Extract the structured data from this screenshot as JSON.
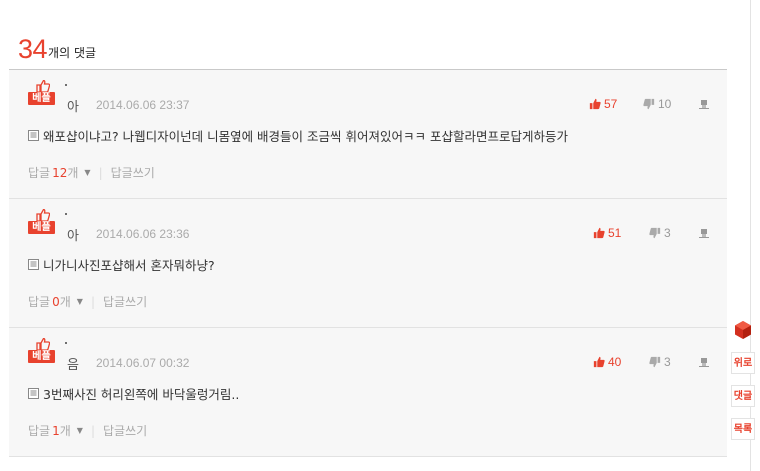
{
  "header": {
    "count": "34",
    "suffix": "개의 댓글"
  },
  "comments": [
    {
      "badge": "베플",
      "author": "아",
      "date": "2014.06.06 23:37",
      "likes": "57",
      "dislikes": "10",
      "text": "왜포샵이냐고? 나웹디자이넌데 니몸옆에 배경들이 조금씩 휘어져있어ㅋㅋ 포샵할라면프로답게하등가",
      "reply_label": "답글",
      "reply_count": "12",
      "reply_unit": "개",
      "write_reply": "답글쓰기"
    },
    {
      "badge": "베플",
      "author": "아",
      "date": "2014.06.06 23:36",
      "likes": "51",
      "dislikes": "3",
      "text": "니가니사진포샵해서 혼자뭐하냥?",
      "reply_label": "답글",
      "reply_count": "0",
      "reply_unit": "개",
      "write_reply": "답글쓰기"
    },
    {
      "badge": "베플",
      "author": "음",
      "date": "2014.06.07 00:32",
      "likes": "40",
      "dislikes": "3",
      "text": "3번째사진 허리왼쪽에 바닥울렁거림..",
      "reply_label": "답글",
      "reply_count": "1",
      "reply_unit": "개",
      "write_reply": "답글쓰기"
    }
  ],
  "sidebar": {
    "top": "위로",
    "comments": "댓글",
    "list": "목록"
  },
  "icons": {
    "like": "thumbs-up-icon",
    "dislike": "thumbs-down-icon",
    "report": "report-icon",
    "doc": "document-icon",
    "badge": "best-thumb-icon",
    "side": "cube-icon"
  },
  "colors": {
    "accent": "#e8422e",
    "muted": "#aaaaaa",
    "card_bg": "#f7f7f7"
  }
}
